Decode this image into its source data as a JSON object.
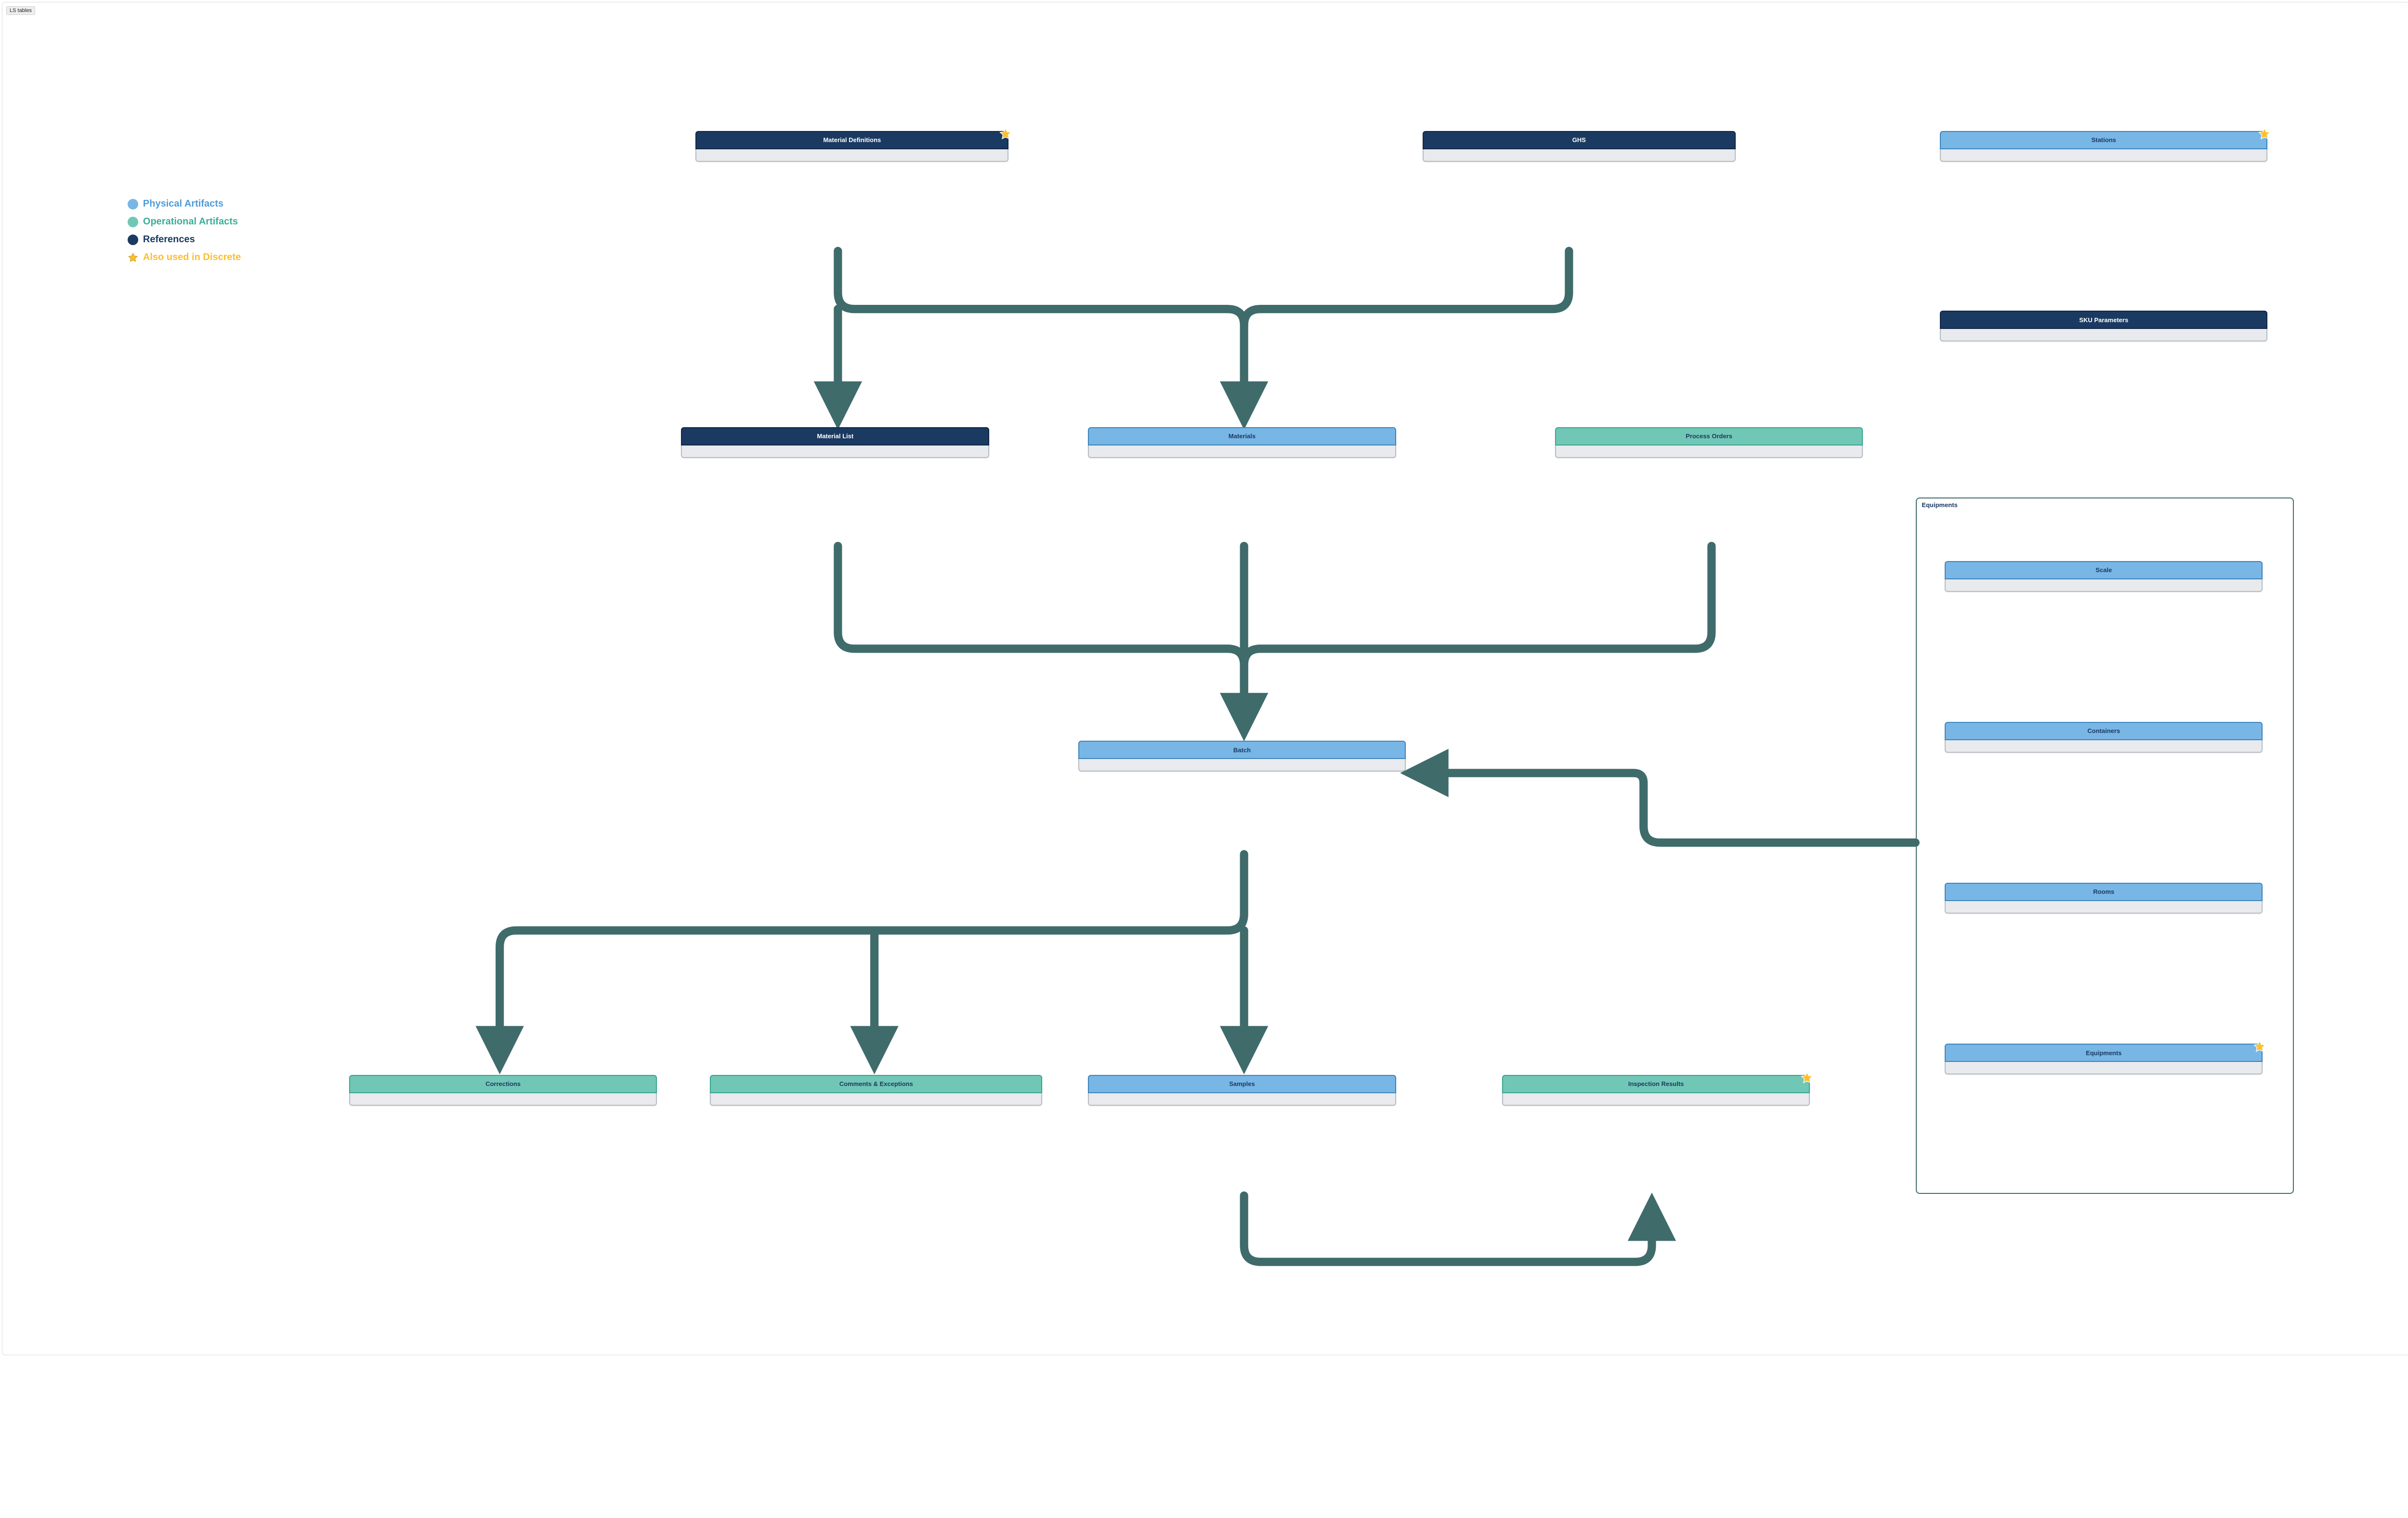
{
  "badge": "LS tables",
  "legend": {
    "physical": "Physical Artifacts",
    "operational": "Operational Artifacts",
    "references": "References",
    "discrete": "Also used in Discrete"
  },
  "colors": {
    "physical": "#78b6e6",
    "operational": "#71c7b6",
    "references": "#1b3a62",
    "star": "#fbc02d",
    "connector": "#3f6b6b"
  },
  "nodes": {
    "material_definitions": {
      "label": "Material Definitions",
      "type": "references",
      "star": true
    },
    "ghs": {
      "label": "GHS",
      "type": "references",
      "star": false
    },
    "stations": {
      "label": "Stations",
      "type": "physical",
      "star": true
    },
    "sku_parameters": {
      "label": "SKU Parameters",
      "type": "references",
      "star": false
    },
    "material_list": {
      "label": "Material List",
      "type": "references",
      "star": false
    },
    "materials": {
      "label": "Materials",
      "type": "physical",
      "star": false
    },
    "process_orders": {
      "label": "Process Orders",
      "type": "operational",
      "star": false
    },
    "batch": {
      "label": "Batch",
      "type": "physical",
      "star": false
    },
    "corrections": {
      "label": "Corrections",
      "type": "operational",
      "star": false
    },
    "comments_exceptions": {
      "label": "Comments & Exceptions",
      "type": "operational",
      "star": false
    },
    "samples": {
      "label": "Samples",
      "type": "physical",
      "star": false
    },
    "inspection_results": {
      "label": "Inspection Results",
      "type": "operational",
      "star": true
    },
    "scale": {
      "label": "Scale",
      "type": "physical",
      "star": false
    },
    "containers": {
      "label": "Containers",
      "type": "physical",
      "star": false
    },
    "rooms": {
      "label": "Rooms",
      "type": "physical",
      "star": false
    },
    "equipments": {
      "label": "Equipments",
      "type": "physical",
      "star": true
    }
  },
  "group": {
    "title": "Equipments"
  },
  "edges": [
    {
      "from": "material_definitions",
      "to": "material_list"
    },
    {
      "from": "material_definitions",
      "to": "materials"
    },
    {
      "from": "ghs",
      "to": "materials"
    },
    {
      "from": "material_list",
      "to": "batch"
    },
    {
      "from": "materials",
      "to": "batch"
    },
    {
      "from": "process_orders",
      "to": "batch"
    },
    {
      "from": "equipments_group",
      "to": "batch"
    },
    {
      "from": "batch",
      "to": "corrections"
    },
    {
      "from": "batch",
      "to": "comments_exceptions"
    },
    {
      "from": "batch",
      "to": "samples"
    },
    {
      "from": "samples",
      "to": "inspection_results"
    }
  ]
}
